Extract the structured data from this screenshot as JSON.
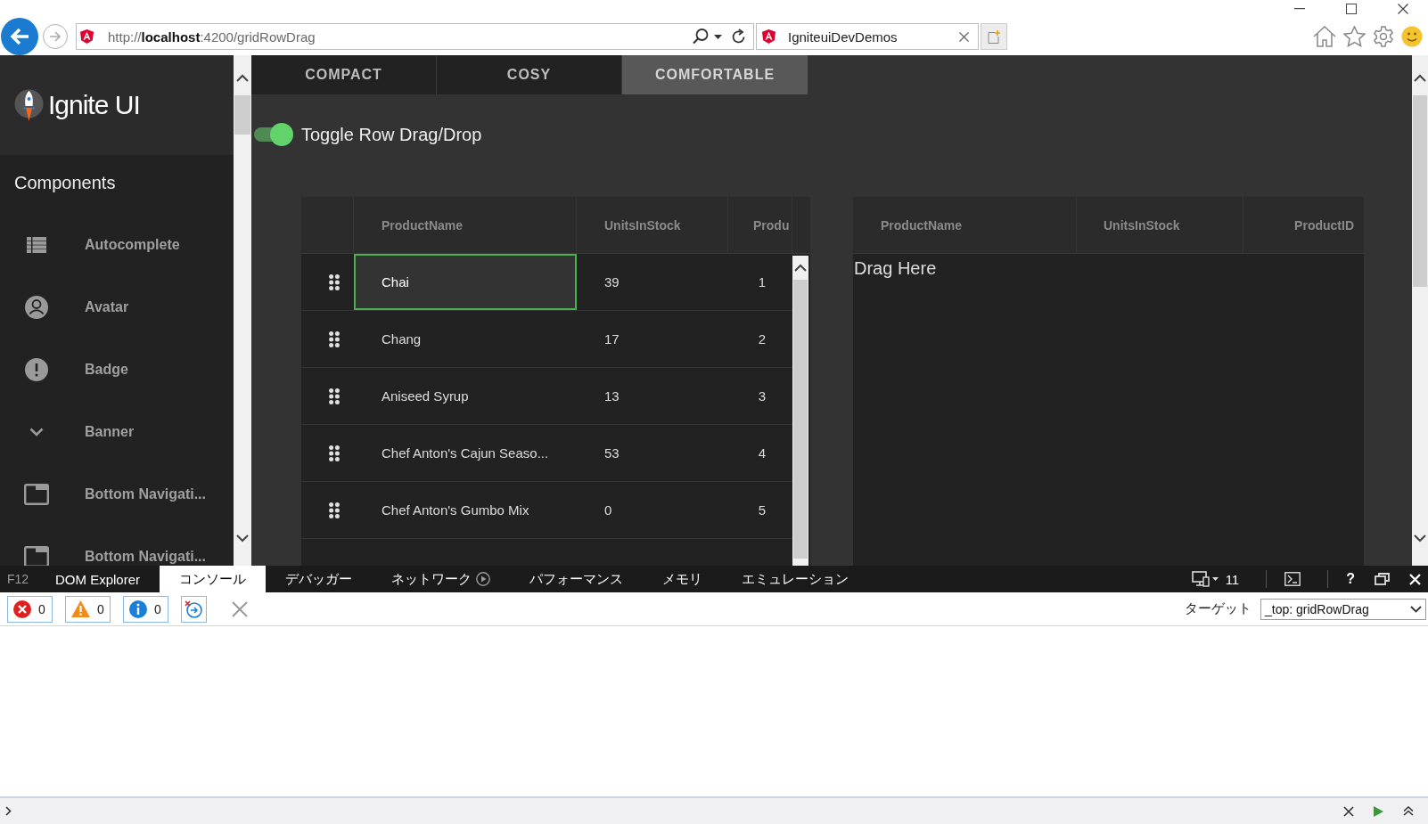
{
  "browser": {
    "address": "http://**localhost**:4200/gridRowDrag",
    "tab_title": "IgniteuiDevDemos"
  },
  "sidebar": {
    "logo_text": "Ignite UI",
    "section_title": "Components",
    "items": [
      {
        "label": "Autocomplete",
        "selected": false
      },
      {
        "label": "Avatar",
        "selected": false
      },
      {
        "label": "Badge",
        "selected": false
      },
      {
        "label": "Banner",
        "selected": false
      },
      {
        "label": "Bottom Navigati...",
        "selected": false
      },
      {
        "label": "Bottom Navigati...",
        "selected": false
      }
    ]
  },
  "density_tabs": [
    {
      "label": "COMPACT",
      "selected": false
    },
    {
      "label": "COSY",
      "selected": false
    },
    {
      "label": "COMFORTABLE",
      "selected": true
    }
  ],
  "toggle": {
    "label": "Toggle Row Drag/Drop",
    "on": true
  },
  "source_grid": {
    "columns": [
      "ProductName",
      "UnitsInStock",
      "Produ"
    ],
    "rows": [
      {
        "cells": [
          "Chai",
          "39",
          "1"
        ],
        "selected": true
      },
      {
        "cells": [
          "Chang",
          "17",
          "2"
        ],
        "selected": false
      },
      {
        "cells": [
          "Aniseed Syrup",
          "13",
          "3"
        ],
        "selected": false
      },
      {
        "cells": [
          "Chef Anton's Cajun Seaso...",
          "53",
          "4"
        ],
        "selected": false
      },
      {
        "cells": [
          "Chef Anton's Gumbo Mix",
          "0",
          "5"
        ],
        "selected": false
      }
    ]
  },
  "target_grid": {
    "columns": [
      "ProductName",
      "UnitsInStock",
      "ProductID"
    ],
    "empty_text": "Drag Here"
  },
  "devtools": {
    "label": "F12",
    "tabs": [
      {
        "label": "DOM Explorer",
        "selected": false
      },
      {
        "label": "コンソール",
        "selected": true
      },
      {
        "label": "デバッガー",
        "selected": false
      },
      {
        "label": "ネットワーク",
        "selected": false
      },
      {
        "label": "パフォーマンス",
        "selected": false
      },
      {
        "label": "メモリ",
        "selected": false
      },
      {
        "label": "エミュレーション",
        "selected": false
      }
    ],
    "document_mode": "11",
    "help": "?",
    "counters": [
      {
        "kind": "error",
        "count": "0"
      },
      {
        "kind": "warning",
        "count": "0"
      },
      {
        "kind": "info",
        "count": "0"
      }
    ],
    "target_label": "ターゲット",
    "target_value": "_top: gridRowDrag"
  }
}
